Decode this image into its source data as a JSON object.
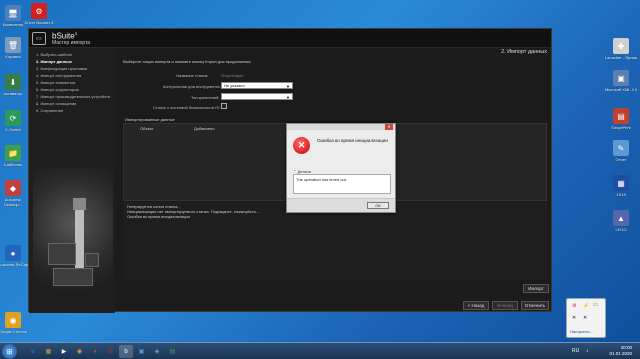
{
  "desktop": {
    "left_icons": [
      {
        "label": "Компьютер",
        "glyph": "🖥",
        "color": "#4a7fc0"
      },
      {
        "label": "Корзина",
        "glyph": "🗑",
        "color": "#7a9bbf"
      },
      {
        "label": "Активатор",
        "glyph": "⬇",
        "color": "#3a7d44"
      },
      {
        "label": "C-Switch",
        "glyph": "⟳",
        "color": "#2a9a5a"
      },
      {
        "label": "Шаблоны",
        "glyph": "📁",
        "color": "#3aa14a"
      },
      {
        "label": "Autodesk Desktop...",
        "glyph": "◆",
        "color": "#c04040"
      },
      {
        "label": "Autodesk ReCap",
        "glyph": "●",
        "color": "#2266bb"
      },
      {
        "label": "Google Chrome",
        "glyph": "◉",
        "color": "#e0a020"
      }
    ],
    "top_icon": {
      "label": "Driver Booster 6",
      "glyph": "⚙",
      "color": "#d02020"
    },
    "right_icons": [
      {
        "label": "Launcher - Ярлык",
        "glyph": "✚",
        "color": "#d0d0d0"
      },
      {
        "label": "Microsoft XML 4.0",
        "glyph": "▣",
        "color": "#5b7fb0"
      },
      {
        "label": "EasyePrint",
        "glyph": "▤",
        "color": "#c04030"
      },
      {
        "label": "Отчет",
        "glyph": "✎",
        "color": "#5a9ad0"
      },
      {
        "label": "1S18",
        "glyph": "▦",
        "color": "#1d4fa0"
      },
      {
        "label": "LEGO",
        "glyph": "▲",
        "color": "#5566aa"
      }
    ]
  },
  "app": {
    "logo_glyph": "▭",
    "title": "bSuite",
    "title_sup": "3",
    "subtitle": "Мастер импорта",
    "step_title": "2. Импорт данных",
    "sidebar": [
      {
        "label": "1. Выбрать шаблон",
        "active": false
      },
      {
        "label": "2. Импорт данных",
        "active": true
      },
      {
        "label": "3. Конфигурация проставки",
        "active": false
      },
      {
        "label": "4. Импорт инструментов",
        "active": false
      },
      {
        "label": "5. Импорт элементов",
        "active": false
      },
      {
        "label": "6. Импорт корректоров",
        "active": false
      },
      {
        "label": "7. Импорт производительных устройств",
        "active": false
      },
      {
        "label": "8. Импорт оснащения",
        "active": false
      },
      {
        "label": "9. Сохранение",
        "active": false
      }
    ],
    "instruction": "Выберите опции импорта и нажмите кнопку Import для продолжения",
    "form": {
      "machine_label": "Название станка:",
      "machine_value": "Отсутствует",
      "workspace_label": "Контрольная для инструмента:",
      "workspace_value": "Не указано",
      "tool_type_label": "Тип креплений:",
      "tool_type_value": "",
      "safety_label": "Станок с системой безопасности IS:"
    },
    "table": {
      "title": "Импортированные данные",
      "col_object": "Объект",
      "col_added": "Добавлено"
    },
    "log": [
      "Генерируется копия станка...",
      "Инициализация нет импортируемого станка. Подождите, пожалуйста...",
      "Ошибка во время инициализации"
    ],
    "buttons": {
      "import": "Импорт",
      "back": "< Назад",
      "next": "Вперед",
      "cancel": "Отменить"
    }
  },
  "modal": {
    "title": "Ошибка во время инициализации",
    "close_glyph": "✕",
    "error_glyph": "✕",
    "details_label": "Детали",
    "details_text": "The operation has timed out.",
    "ok_label": "ОК"
  },
  "tray_popup": {
    "link": "Настроить..."
  },
  "taskbar": {
    "start_glyph": "⊞",
    "apps": [
      {
        "glyph": "e",
        "color": "#2a7fd0",
        "active": false
      },
      {
        "glyph": "▦",
        "color": "#d0a030",
        "active": false
      },
      {
        "glyph": "▶",
        "color": "#ffffff",
        "active": false
      },
      {
        "glyph": "◉",
        "color": "#e0a020",
        "active": false
      },
      {
        "glyph": "●",
        "color": "#c04040",
        "active": false
      },
      {
        "glyph": "⚙",
        "color": "#d02020",
        "active": false
      },
      {
        "glyph": "b",
        "color": "#ffffff",
        "active": true
      },
      {
        "glyph": "▣",
        "color": "#5a9ad0",
        "active": false
      },
      {
        "glyph": "◈",
        "color": "#7aa0d0",
        "active": false
      },
      {
        "glyph": "▤",
        "color": "#40a060",
        "active": false
      }
    ],
    "language": "RU",
    "time": "20:00",
    "date": "01.01.2020"
  }
}
